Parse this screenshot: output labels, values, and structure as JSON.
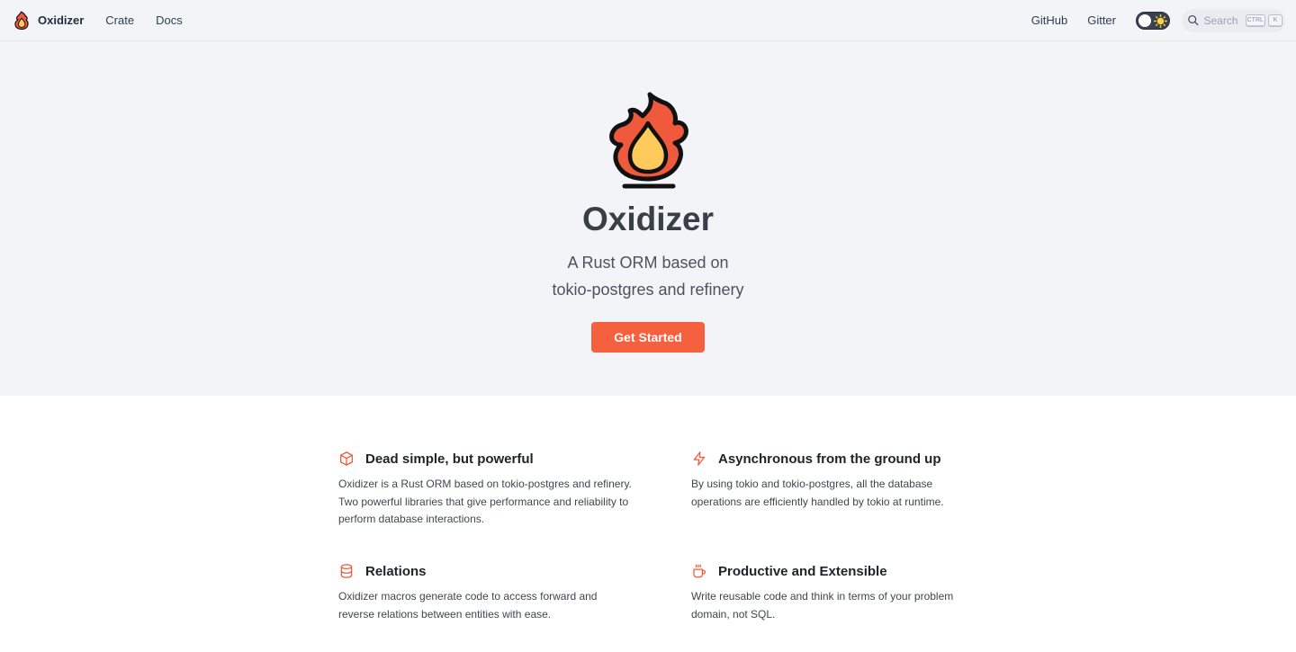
{
  "navbar": {
    "brand": "Oxidizer",
    "links": [
      "Crate",
      "Docs"
    ],
    "right_links": [
      "GitHub",
      "Gitter"
    ],
    "search_placeholder": "Search",
    "search_keys": [
      "CTRL",
      "K"
    ]
  },
  "hero": {
    "title": "Oxidizer",
    "tagline_line1": "A Rust ORM based on",
    "tagline_line2": "tokio-postgres and refinery",
    "cta": "Get Started"
  },
  "features": [
    {
      "icon": "box-icon",
      "title": "Dead simple, but powerful",
      "text": "Oxidizer is a Rust ORM based on tokio-postgres and refinery. Two powerful libraries that give performance and reliability to perform database interactions."
    },
    {
      "icon": "lightning-icon",
      "title": "Asynchronous from the ground up",
      "text": "By using tokio and tokio-postgres, all the database operations are efficiently handled by tokio at runtime."
    },
    {
      "icon": "database-icon",
      "title": "Relations",
      "text": "Oxidizer macros generate code to access forward and reverse relations between entities with ease."
    },
    {
      "icon": "coffee-cup-icon",
      "title": "Productive and Extensible",
      "text": "Write reusable code and think in terms of your problem domain, not SQL."
    }
  ],
  "colors": {
    "accent": "#f5603f",
    "hero_bg": "#f2f4f8",
    "flame_outer": "#f05a3c",
    "flame_inner": "#ffc95c"
  }
}
